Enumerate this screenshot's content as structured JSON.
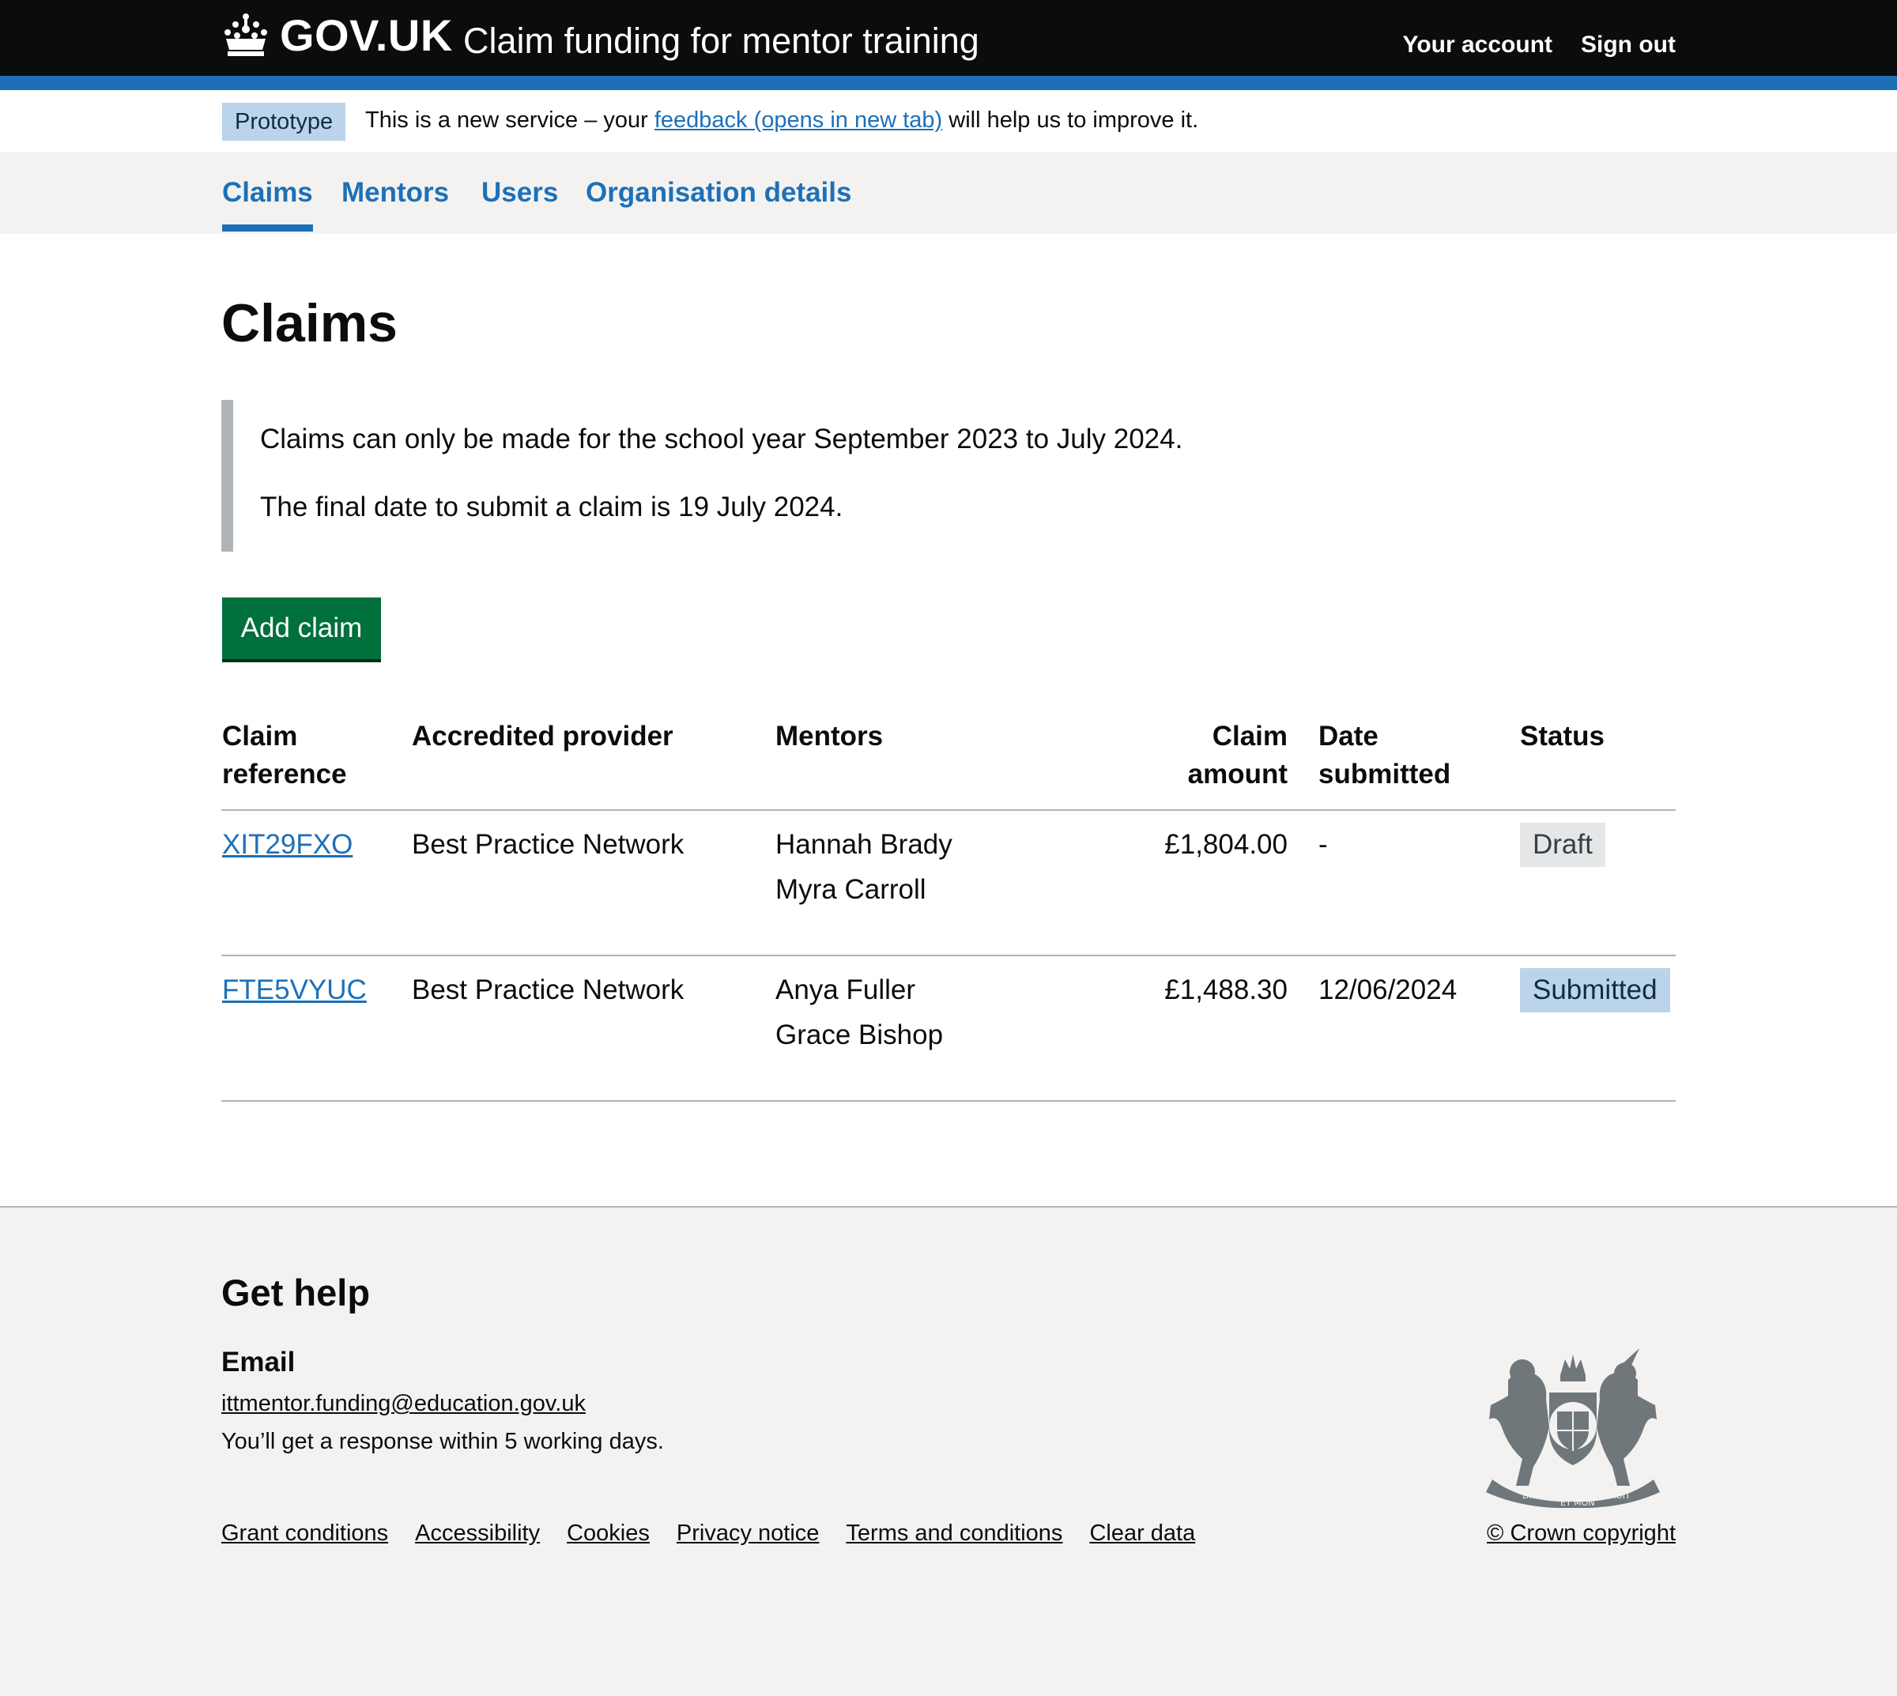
{
  "header": {
    "logo_text": "GOV.UK",
    "service_name": "Claim funding for mentor training",
    "nav": [
      "Your account",
      "Sign out"
    ]
  },
  "phase_banner": {
    "tag": "Prototype",
    "text_before": "This is a new service – your ",
    "link": "feedback (opens in new tab)",
    "text_after": " will help us to improve it."
  },
  "subnav": {
    "items": [
      "Claims",
      "Mentors",
      "Users",
      "Organisation details"
    ],
    "active": "Claims"
  },
  "main": {
    "title": "Claims",
    "inset": [
      "Claims can only be made for the school year September 2023 to July 2024.",
      "The final date to submit a claim is 19 July 2024."
    ],
    "add_button": "Add claim"
  },
  "table": {
    "headers": {
      "reference": [
        "Claim",
        "reference"
      ],
      "provider": "Accredited provider",
      "mentors": "Mentors",
      "amount": [
        "Claim",
        "amount"
      ],
      "date": [
        "Date",
        "submitted"
      ],
      "status": "Status"
    },
    "rows": [
      {
        "reference": "XIT29FXO",
        "provider": "Best Practice Network",
        "mentors": [
          "Hannah Brady",
          "Myra Carroll"
        ],
        "amount": "£1,804.00",
        "date": "-",
        "status": "Draft"
      },
      {
        "reference": "FTE5VYUC",
        "provider": "Best Practice Network",
        "mentors": [
          "Anya Fuller",
          "Grace Bishop"
        ],
        "amount": "£1,488.30",
        "date": "12/06/2024",
        "status": "Submitted"
      }
    ]
  },
  "footer": {
    "title": "Get help",
    "email_heading": "Email",
    "email": "ittmentor.funding@education.gov.uk",
    "response": "You’ll get a response within 5 working days.",
    "links": [
      "Grant conditions",
      "Accessibility",
      "Cookies",
      "Privacy notice",
      "Terms and conditions",
      "Clear data"
    ],
    "copyright": "© Crown copyright",
    "crest_icon": "royal-coat-of-arms-icon",
    "crest_motto": [
      "DIEU",
      "ET MON",
      "DROIT"
    ]
  },
  "colors": {
    "header": "#0b0c0c",
    "brand_blue": "#1d70b8",
    "button_green": "#00703c",
    "footer_bg": "#f3f2f1"
  }
}
